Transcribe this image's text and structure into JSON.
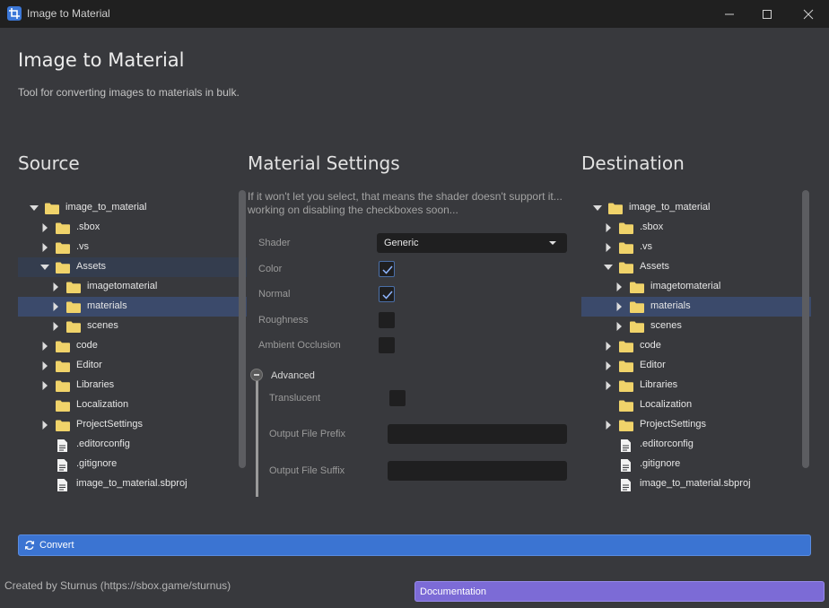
{
  "window": {
    "title": "Image to Material"
  },
  "header": {
    "title": "Image to Material",
    "subtitle": "Tool for converting images to materials in bulk."
  },
  "source": {
    "heading": "Source",
    "tree": [
      {
        "label": "image_to_material",
        "depth": 0,
        "type": "folder",
        "state": "expanded"
      },
      {
        "label": ".sbox",
        "depth": 1,
        "type": "folder",
        "state": "collapsed"
      },
      {
        "label": ".vs",
        "depth": 1,
        "type": "folder",
        "state": "collapsed"
      },
      {
        "label": "Assets",
        "depth": 1,
        "type": "folder",
        "state": "expanded"
      },
      {
        "label": "imagetomaterial",
        "depth": 2,
        "type": "folder",
        "state": "collapsed"
      },
      {
        "label": "materials",
        "depth": 2,
        "type": "folder",
        "state": "collapsed",
        "selected": true
      },
      {
        "label": "scenes",
        "depth": 2,
        "type": "folder",
        "state": "collapsed"
      },
      {
        "label": "code",
        "depth": 1,
        "type": "folder",
        "state": "collapsed"
      },
      {
        "label": "Editor",
        "depth": 1,
        "type": "folder",
        "state": "collapsed"
      },
      {
        "label": "Libraries",
        "depth": 1,
        "type": "folder",
        "state": "collapsed"
      },
      {
        "label": "Localization",
        "depth": 1,
        "type": "folder",
        "state": "none"
      },
      {
        "label": "ProjectSettings",
        "depth": 1,
        "type": "folder",
        "state": "collapsed"
      },
      {
        "label": ".editorconfig",
        "depth": 1,
        "type": "file"
      },
      {
        "label": ".gitignore",
        "depth": 1,
        "type": "file"
      },
      {
        "label": "image_to_material.sbproj",
        "depth": 1,
        "type": "file"
      }
    ]
  },
  "settings": {
    "heading": "Material Settings",
    "note": "If it won't let you select, that means the shader doesn't support it... working on disabling the checkboxes soon...",
    "shader_label": "Shader",
    "shader_value": "Generic",
    "color_label": "Color",
    "color_checked": true,
    "normal_label": "Normal",
    "normal_checked": true,
    "roughness_label": "Roughness",
    "roughness_checked": false,
    "ao_label": "Ambient Occlusion",
    "ao_checked": false,
    "advanced_label": "Advanced",
    "translucent_label": "Translucent",
    "translucent_checked": false,
    "prefix_label": "Output File Prefix",
    "prefix_value": "",
    "suffix_label": "Output File Suffix",
    "suffix_value": ""
  },
  "destination": {
    "heading": "Destination",
    "tree": [
      {
        "label": "image_to_material",
        "depth": 0,
        "type": "folder",
        "state": "expanded"
      },
      {
        "label": ".sbox",
        "depth": 1,
        "type": "folder",
        "state": "collapsed"
      },
      {
        "label": ".vs",
        "depth": 1,
        "type": "folder",
        "state": "collapsed"
      },
      {
        "label": "Assets",
        "depth": 1,
        "type": "folder",
        "state": "expanded"
      },
      {
        "label": "imagetomaterial",
        "depth": 2,
        "type": "folder",
        "state": "collapsed"
      },
      {
        "label": "materials",
        "depth": 2,
        "type": "folder",
        "state": "collapsed",
        "selected": true
      },
      {
        "label": "scenes",
        "depth": 2,
        "type": "folder",
        "state": "collapsed"
      },
      {
        "label": "code",
        "depth": 1,
        "type": "folder",
        "state": "collapsed"
      },
      {
        "label": "Editor",
        "depth": 1,
        "type": "folder",
        "state": "collapsed"
      },
      {
        "label": "Libraries",
        "depth": 1,
        "type": "folder",
        "state": "collapsed"
      },
      {
        "label": "Localization",
        "depth": 1,
        "type": "folder",
        "state": "none"
      },
      {
        "label": "ProjectSettings",
        "depth": 1,
        "type": "folder",
        "state": "collapsed"
      },
      {
        "label": ".editorconfig",
        "depth": 1,
        "type": "file"
      },
      {
        "label": ".gitignore",
        "depth": 1,
        "type": "file"
      },
      {
        "label": "image_to_material.sbproj",
        "depth": 1,
        "type": "file"
      }
    ]
  },
  "actions": {
    "convert_label": "Convert",
    "documentation_label": "Documentation"
  },
  "footer": {
    "credit": "Created by Sturnus (https://sbox.game/sturnus)"
  },
  "colors": {
    "accent": "#3b74d2",
    "documentation": "#7c6bd6",
    "folder": "#f0d36a",
    "selection": "#3b4a6b"
  }
}
